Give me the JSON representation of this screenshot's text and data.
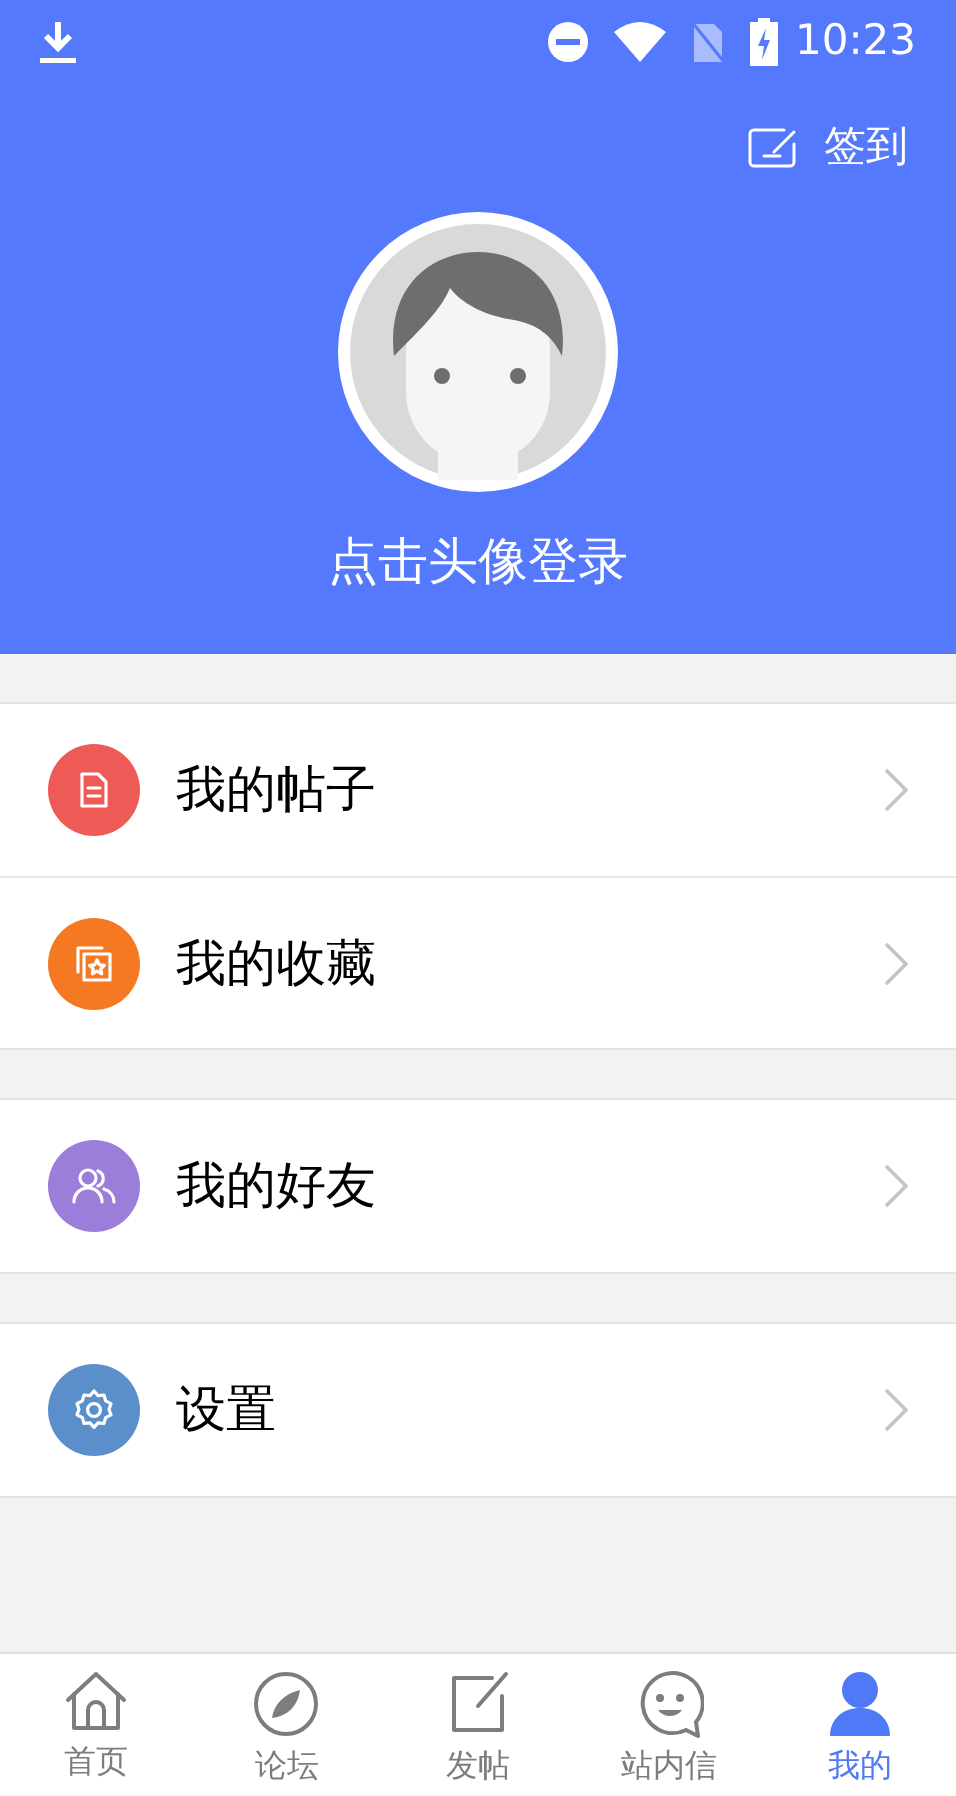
{
  "status_bar": {
    "time": "10:23"
  },
  "header": {
    "sign_in": "签到",
    "login_prompt": "点击头像登录"
  },
  "menu_groups": [
    {
      "items": [
        {
          "kind": "posts",
          "label": "我的帖子",
          "color": "#ee5a56"
        },
        {
          "kind": "favorites",
          "label": "我的收藏",
          "color": "#f57923"
        }
      ]
    },
    {
      "items": [
        {
          "kind": "friends",
          "label": "我的好友",
          "color": "#9a7ed9"
        }
      ]
    },
    {
      "items": [
        {
          "kind": "settings",
          "label": "设置",
          "color": "#5b8fcb"
        }
      ]
    }
  ],
  "nav_tabs": [
    {
      "kind": "home",
      "label": "首页",
      "selected": false
    },
    {
      "kind": "forum",
      "label": "论坛",
      "selected": false
    },
    {
      "kind": "post",
      "label": "发帖",
      "selected": false
    },
    {
      "kind": "messages",
      "label": "站内信",
      "selected": false
    },
    {
      "kind": "me",
      "label": "我的",
      "selected": true
    }
  ]
}
